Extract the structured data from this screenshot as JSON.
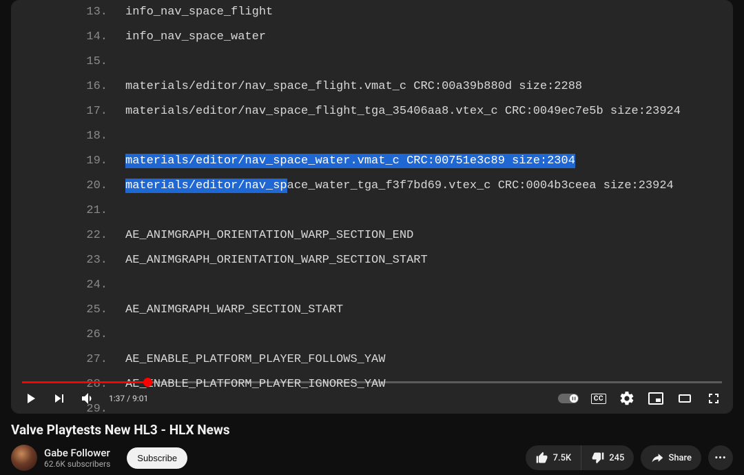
{
  "video": {
    "title": "Valve Playtests New HL3 - HLX News",
    "channel": "Gabe Follower",
    "subscribers": "62.6K subscribers",
    "subscribe_label": "Subscribe",
    "likes": "7.5K",
    "dislikes": "245",
    "share_label": "Share",
    "time_current": "1:37",
    "time_total": "9:01",
    "progress_percent": 17.9,
    "cc_label": "CC"
  },
  "code": {
    "lines": [
      {
        "num": "13.",
        "text": "info_nav_space_flight"
      },
      {
        "num": "14.",
        "text": "info_nav_space_water"
      },
      {
        "num": "15.",
        "text": ""
      },
      {
        "num": "16.",
        "text": "materials/editor/nav_space_flight.vmat_c CRC:00a39b880d size:2288"
      },
      {
        "num": "17.",
        "text": "materials/editor/nav_space_flight_tga_35406aa8.vtex_c CRC:0049ec7e5b size:23924"
      },
      {
        "num": "18.",
        "text": ""
      },
      {
        "num": "19.",
        "text": "materials/editor/nav_space_water.vmat_c CRC:00751e3c89 size:2304",
        "full_highlight": true
      },
      {
        "num": "20.",
        "prefix": "materials/editor/nav_sp",
        "suffix": "ace_water_tga_f3f7bd69.vtex_c CRC:0004b3ceea size:23924",
        "partial": true
      },
      {
        "num": "21.",
        "text": ""
      },
      {
        "num": "22.",
        "text": "AE_ANIMGRAPH_ORIENTATION_WARP_SECTION_END"
      },
      {
        "num": "23.",
        "text": "AE_ANIMGRAPH_ORIENTATION_WARP_SECTION_START"
      },
      {
        "num": "24.",
        "text": ""
      },
      {
        "num": "25.",
        "text": "AE_ANIMGRAPH_WARP_SECTION_START"
      },
      {
        "num": "26.",
        "text": ""
      },
      {
        "num": "27.",
        "text": "AE_ENABLE_PLATFORM_PLAYER_FOLLOWS_YAW"
      },
      {
        "num": "28.",
        "text": "AE_ENABLE_PLATFORM_PLAYER_IGNORES_YAW"
      },
      {
        "num": "29.",
        "text": ""
      }
    ]
  }
}
